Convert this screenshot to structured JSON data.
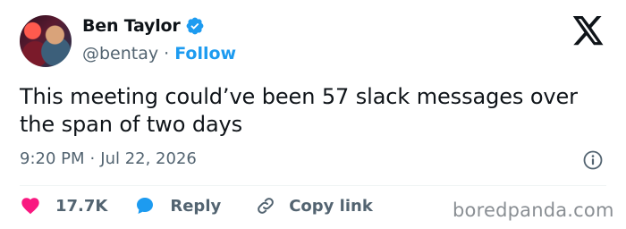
{
  "author": {
    "name": "Ben Taylor",
    "handle": "@bentay",
    "separator": "·",
    "follow_label": "Follow",
    "verified_icon": "verified-badge-icon",
    "verified_color": "#1d9bf0"
  },
  "platform_logo": "x-logo-icon",
  "tweet": {
    "text": "This meeting could’ve been 57 slack messages over the span of two days"
  },
  "meta": {
    "time": "9:20 PM",
    "separator": "·",
    "date": "Jul 22, 2026",
    "info_icon": "info-icon"
  },
  "actions": {
    "like": {
      "icon": "heart-icon",
      "count": "17.7K",
      "color": "#f91880"
    },
    "reply": {
      "icon": "reply-bubble-icon",
      "label": "Reply",
      "color": "#1d9bf0"
    },
    "copy_link": {
      "icon": "link-icon",
      "label": "Copy link"
    }
  },
  "watermark": "boredpanda.com",
  "colors": {
    "text_primary": "#0f1419",
    "text_secondary": "#536471",
    "accent": "#1d9bf0",
    "like": "#f91880"
  }
}
